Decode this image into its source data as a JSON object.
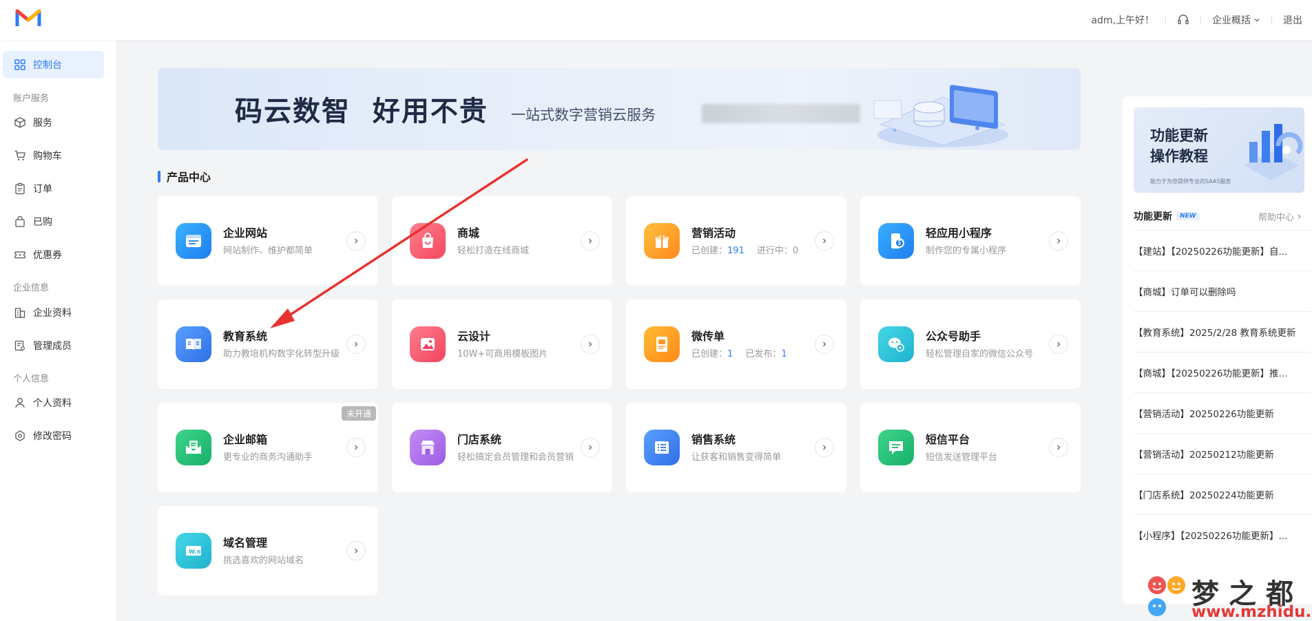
{
  "header": {
    "greeting": "adm,上午好！",
    "company_menu": "企业概括",
    "logout": "退出"
  },
  "sidebar": {
    "dashboard": "控制台",
    "groups": {
      "account": "账户服务",
      "company": "企业信息",
      "personal": "个人信息"
    },
    "items": [
      {
        "label": "服务"
      },
      {
        "label": "购物车"
      },
      {
        "label": "订单"
      },
      {
        "label": "已购"
      },
      {
        "label": "优惠券"
      },
      {
        "label": "企业资料"
      },
      {
        "label": "管理成员"
      },
      {
        "label": "个人资料"
      },
      {
        "label": "修改密码"
      }
    ]
  },
  "banner": {
    "title": "码云数智  好用不贵",
    "subtitle": "一站式数字营销云服务"
  },
  "products": {
    "section_title": "产品中心",
    "items": [
      {
        "name": "企业网站",
        "desc": "网站制作、维护都简单"
      },
      {
        "name": "商城",
        "desc": "轻松打造在线商城"
      },
      {
        "name": "营销活动",
        "created_label": "已创建：",
        "created": "191",
        "running_label": "进行中：",
        "running": "0"
      },
      {
        "name": "轻应用小程序",
        "desc": "制作您的专属小程序"
      },
      {
        "name": "教育系统",
        "desc": "助力教培机构数字化转型升级"
      },
      {
        "name": "云设计",
        "desc": "10W+可商用模板图片"
      },
      {
        "name": "微传单",
        "created_label": "已创建：",
        "created": "1",
        "published_label": "已发布：",
        "published": "1"
      },
      {
        "name": "公众号助手",
        "desc": "轻松管理自家的微信公众号"
      },
      {
        "name": "企业邮箱",
        "desc": "更专业的商务沟通助手",
        "tag": "未开通"
      },
      {
        "name": "门店系统",
        "desc": "轻松搞定会员管理和会员营销"
      },
      {
        "name": "销售系统",
        "desc": "让获客和销售变得简单"
      },
      {
        "name": "短信平台",
        "desc": "短信发送管理平台"
      },
      {
        "name": "域名管理",
        "desc": "挑选喜欢的网站域名"
      }
    ]
  },
  "right_panel": {
    "promo_line1": "功能更新",
    "promo_line2": "操作教程",
    "promo_small": "助力于为您提供专业的SAAS服务",
    "updates_title": "功能更新",
    "new_badge": "NEW",
    "help_center": "帮助中心",
    "updates": [
      "【建站】【20250226功能更新】自...",
      "【商城】订单可以删除吗",
      "【教育系统】2025/2/28 教育系统更新",
      "【商城】【20250226功能更新】推...",
      "【营销活动】20250226功能更新",
      "【营销活动】20250212功能更新",
      "【门店系统】20250224功能更新",
      "【小程序】【20250226功能更新】..."
    ]
  },
  "watermark": {
    "text": "梦之都",
    "url": "www.mzhidu.com"
  },
  "colors": {
    "accent": "#2f7cf6",
    "annotation_arrow": "#e8322f"
  }
}
